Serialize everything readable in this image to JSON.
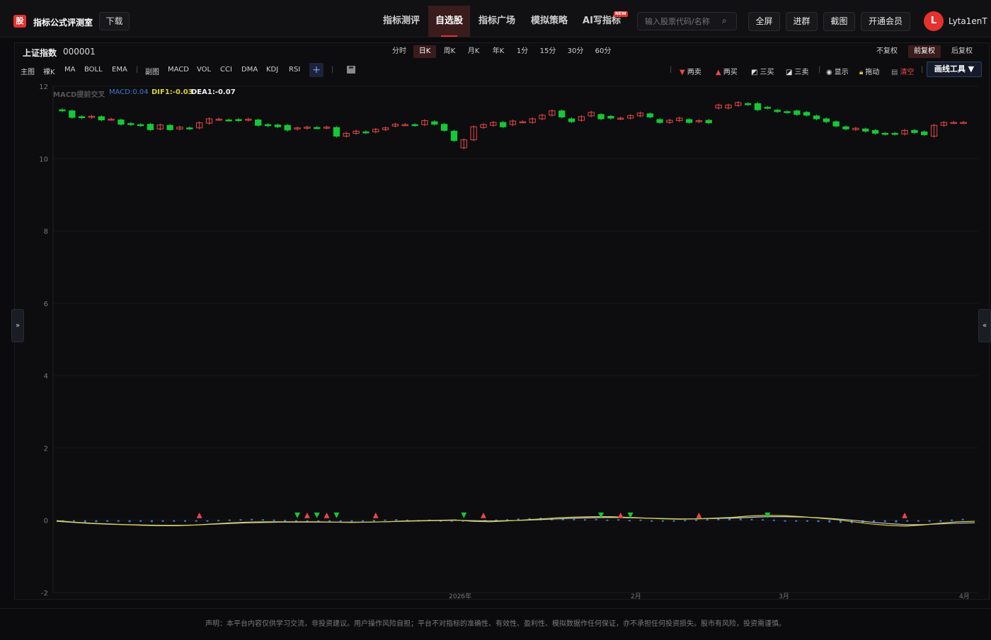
{
  "header": {
    "logo_char": "股",
    "brand": "指标公式评测室",
    "download": "下载",
    "nav": [
      "指标测评",
      "自选股",
      "指标广场",
      "模拟策略",
      "AI写指标"
    ],
    "new_badge": "NEW",
    "search_placeholder": "输入股票代码/名称",
    "buttons": [
      "全屏",
      "进群",
      "截图",
      "开通会员"
    ],
    "avatar": "L",
    "username": "Lyta1enT"
  },
  "stock": {
    "name": "上证指数",
    "code": "000001"
  },
  "periods": [
    "分时",
    "日K",
    "周K",
    "月K",
    "年K",
    "1分",
    "15分",
    "30分",
    "60分"
  ],
  "active_period": "日K",
  "adjust": [
    "不复权",
    "前复权",
    "后复权"
  ],
  "active_adjust": "前复权",
  "indicators": {
    "main_label": "主图",
    "main": [
      "裸K",
      "MA",
      "BOLL",
      "EMA"
    ],
    "sub_label": "副图",
    "sub": [
      "MACD",
      "VOL",
      "CCI",
      "DMA",
      "KDJ",
      "RSI"
    ],
    "plus": "+"
  },
  "tools": {
    "two_sell": "两卖",
    "two_buy": "两买",
    "three_buy": "三买",
    "three_sell": "三卖",
    "show": "显示",
    "drag": "拖动",
    "clear": "清空",
    "draw_tool": "画线工具 ▼"
  },
  "chart_legend": {
    "name": "MACD提前交叉",
    "macd": "MACD:0.04",
    "dif": "DIF1:-0.03",
    "dea": "DEA1:-0.07"
  },
  "footer": "声明：本平台内容仅供学习交流，非投资建议。用户操作风险自担；平台不对指标的准确性、有效性、盈利性、模拟数据作任何保证，亦不承担任何投资损失。股市有风险，投资需谨慎。",
  "colors": {
    "up": "#e8474a",
    "down": "#14c935",
    "dif": "#d9d23f",
    "dea": "#c8c8c8",
    "macd_bar": "#3a78d0",
    "accent": "#e5322d"
  },
  "chart_data": {
    "type": "candlestick",
    "ylim": [
      -2,
      12
    ],
    "yticks": [
      12,
      10,
      8,
      6,
      4,
      2,
      0,
      -2
    ],
    "x_labels": [
      "2026年",
      "2月",
      "3月",
      "4月"
    ],
    "candles": [
      [
        11.35,
        11.32
      ],
      [
        11.32,
        11.14
      ],
      [
        11.16,
        11.13
      ],
      [
        11.14,
        11.17
      ],
      [
        11.16,
        11.07
      ],
      [
        11.09,
        11.09
      ],
      [
        11.07,
        10.95
      ],
      [
        10.97,
        10.94
      ],
      [
        10.94,
        10.92
      ],
      [
        10.95,
        10.8
      ],
      [
        10.82,
        10.93
      ],
      [
        10.92,
        10.8
      ],
      [
        10.82,
        10.87
      ],
      [
        10.85,
        10.83
      ],
      [
        10.85,
        10.99
      ],
      [
        10.98,
        11.1
      ],
      [
        11.08,
        11.09
      ],
      [
        11.07,
        11.06
      ],
      [
        11.08,
        11.06
      ],
      [
        11.06,
        11.09
      ],
      [
        11.07,
        10.92
      ],
      [
        10.94,
        10.91
      ],
      [
        10.93,
        10.88
      ],
      [
        10.92,
        10.79
      ],
      [
        10.82,
        10.85
      ],
      [
        10.84,
        10.87
      ],
      [
        10.86,
        10.85
      ],
      [
        10.85,
        10.87
      ],
      [
        10.86,
        10.62
      ],
      [
        10.62,
        10.7
      ],
      [
        10.7,
        10.76
      ],
      [
        10.74,
        10.72
      ],
      [
        10.74,
        10.81
      ],
      [
        10.8,
        10.85
      ],
      [
        10.9,
        10.95
      ],
      [
        10.94,
        10.94
      ],
      [
        10.94,
        10.92
      ],
      [
        10.94,
        11.05
      ],
      [
        11.02,
        10.95
      ],
      [
        10.95,
        10.78
      ],
      [
        10.76,
        10.5
      ],
      [
        10.3,
        10.52
      ],
      [
        10.52,
        10.88
      ],
      [
        10.86,
        10.94
      ],
      [
        10.92,
        11.0
      ],
      [
        11.0,
        10.88
      ],
      [
        10.94,
        11.04
      ],
      [
        11.02,
        11.02
      ],
      [
        11.0,
        11.1
      ],
      [
        11.1,
        11.2
      ],
      [
        11.2,
        11.32
      ],
      [
        11.32,
        11.15
      ],
      [
        11.1,
        11.02
      ],
      [
        11.06,
        11.16
      ],
      [
        11.18,
        11.28
      ],
      [
        11.22,
        11.1
      ],
      [
        11.17,
        11.12
      ],
      [
        11.1,
        11.12
      ],
      [
        11.12,
        11.19
      ],
      [
        11.18,
        11.26
      ],
      [
        11.24,
        11.15
      ],
      [
        11.08,
        11.0
      ],
      [
        11.0,
        11.06
      ],
      [
        11.05,
        11.12
      ],
      [
        11.08,
        11.0
      ],
      [
        11.02,
        11.05
      ],
      [
        11.06,
        10.99
      ],
      [
        11.4,
        11.48
      ],
      [
        11.4,
        11.48
      ],
      [
        11.47,
        11.55
      ],
      [
        11.52,
        11.5
      ],
      [
        11.52,
        11.35
      ],
      [
        11.42,
        11.4
      ],
      [
        11.34,
        11.3
      ],
      [
        11.3,
        11.28
      ],
      [
        11.32,
        11.22
      ],
      [
        11.28,
        11.2
      ],
      [
        11.18,
        11.1
      ],
      [
        11.1,
        11.02
      ],
      [
        11.02,
        10.9
      ],
      [
        10.88,
        10.82
      ],
      [
        10.8,
        10.84
      ],
      [
        10.82,
        10.76
      ],
      [
        10.78,
        10.7
      ],
      [
        10.7,
        10.68
      ],
      [
        10.7,
        10.68
      ],
      [
        10.68,
        10.78
      ],
      [
        10.78,
        10.72
      ],
      [
        10.74,
        10.66
      ],
      [
        10.62,
        10.92
      ],
      [
        10.92,
        11.0
      ],
      [
        11.0,
        11.0
      ],
      [
        11.0,
        11.0
      ]
    ],
    "macd": {
      "bars": [
        -0.05,
        -0.04,
        -0.06,
        -0.05,
        -0.04,
        -0.04,
        -0.05,
        -0.04,
        -0.05,
        -0.04,
        -0.04,
        -0.03,
        -0.02,
        -0.01,
        0.01,
        0.02,
        0.03,
        0.04,
        0.03,
        0.02,
        0.01,
        0.0,
        0.0,
        -0.01,
        -0.02,
        -0.01,
        -0.01,
        0.0,
        0.01,
        0.02,
        0.03,
        0.02,
        0.01,
        0.02,
        0.0,
        -0.03,
        -0.02,
        0.0,
        0.01,
        0.02,
        0.03,
        0.05,
        0.06,
        0.07,
        0.06,
        0.05,
        0.04,
        0.03,
        0.04,
        0.02,
        0.03,
        0.01,
        0.02,
        0.0,
        -0.01,
        0.0,
        0.01,
        0.02,
        0.03,
        0.04,
        0.05,
        0.05,
        0.04,
        0.03,
        0.02,
        0.0,
        -0.02,
        -0.04,
        -0.05,
        -0.06,
        -0.07,
        -0.08,
        -0.07,
        -0.06,
        -0.05,
        -0.06,
        -0.04,
        -0.03,
        -0.02,
        0.0,
        0.02,
        0.04
      ],
      "dif": [
        -0.01,
        -0.05,
        -0.08,
        -0.1,
        -0.12,
        -0.14,
        -0.15,
        -0.15,
        -0.13,
        -0.1,
        -0.07,
        -0.05,
        -0.04,
        -0.04,
        -0.04,
        -0.04,
        -0.05,
        -0.06,
        -0.05,
        -0.04,
        -0.02,
        -0.01,
        0.0,
        0.01,
        -0.03,
        -0.04,
        -0.02,
        0.01,
        0.04,
        0.07,
        0.09,
        0.1,
        0.1,
        0.08,
        0.06,
        0.04,
        0.03,
        0.04,
        0.06,
        0.08,
        0.12,
        0.14,
        0.13,
        0.1,
        0.06,
        0.02,
        -0.04,
        -0.1,
        -0.14,
        -0.16,
        -0.13,
        -0.08,
        -0.04,
        -0.03
      ],
      "dea": [
        -0.03,
        -0.06,
        -0.09,
        -0.11,
        -0.12,
        -0.13,
        -0.14,
        -0.14,
        -0.13,
        -0.11,
        -0.09,
        -0.07,
        -0.06,
        -0.05,
        -0.05,
        -0.05,
        -0.05,
        -0.05,
        -0.05,
        -0.04,
        -0.03,
        -0.02,
        -0.01,
        0.0,
        -0.01,
        -0.02,
        -0.01,
        0.0,
        0.02,
        0.04,
        0.06,
        0.07,
        0.08,
        0.07,
        0.06,
        0.05,
        0.04,
        0.04,
        0.05,
        0.06,
        0.08,
        0.1,
        0.1,
        0.09,
        0.07,
        0.04,
        0.0,
        -0.05,
        -0.09,
        -0.12,
        -0.12,
        -0.1,
        -0.08,
        -0.07
      ]
    },
    "signals": [
      {
        "t": 14,
        "kind": "buy"
      },
      {
        "t": 24,
        "kind": "sell"
      },
      {
        "t": 25,
        "kind": "buy"
      },
      {
        "t": 26,
        "kind": "sell"
      },
      {
        "t": 27,
        "kind": "buy"
      },
      {
        "t": 28,
        "kind": "sell"
      },
      {
        "t": 32,
        "kind": "buy"
      },
      {
        "t": 41,
        "kind": "sell"
      },
      {
        "t": 43,
        "kind": "buy"
      },
      {
        "t": 55,
        "kind": "sell"
      },
      {
        "t": 57,
        "kind": "buy"
      },
      {
        "t": 58,
        "kind": "sell"
      },
      {
        "t": 65,
        "kind": "buy"
      },
      {
        "t": 72,
        "kind": "sell"
      },
      {
        "t": 86,
        "kind": "buy"
      }
    ]
  }
}
